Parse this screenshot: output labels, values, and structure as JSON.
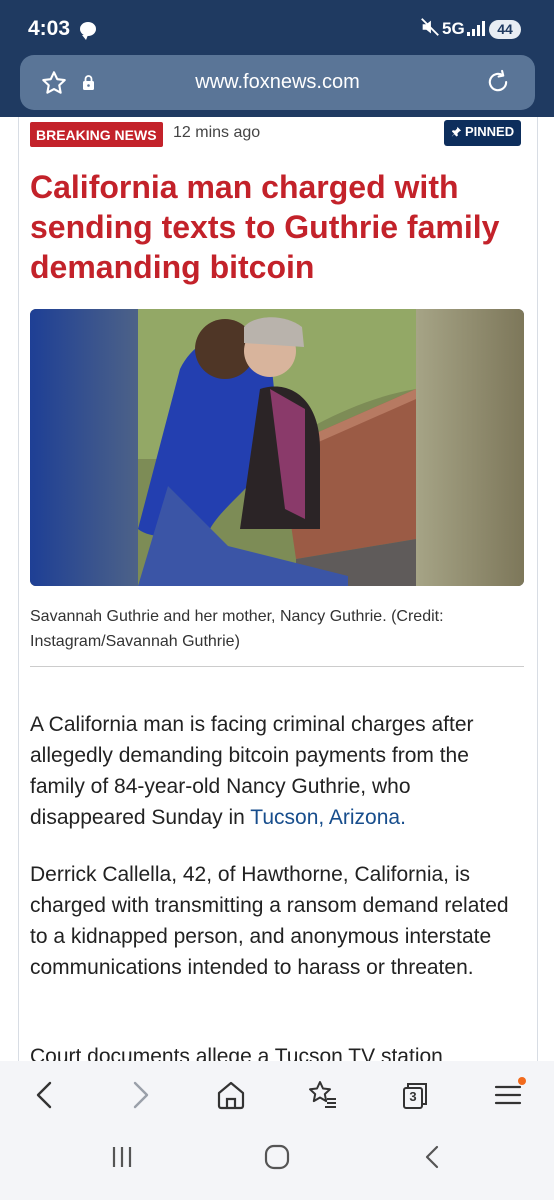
{
  "status": {
    "time": "4:03",
    "network": "5G",
    "battery": "44"
  },
  "browser": {
    "url": "www.foxnews.com"
  },
  "article": {
    "badge": "BREAKING NEWS",
    "time_ago": "12 mins ago",
    "pinned_label": "PINNED",
    "headline": "California man charged with sending texts to Guthrie family demanding bitcoin",
    "caption": "Savannah Guthrie and her mother, Nancy Guthrie. (Credit: Instagram/Savannah Guthrie)",
    "p1_before": "A California man is facing criminal charges after allegedly demanding bitcoin payments from the family of 84-year-old Nancy Guthrie, who disappeared Sunday in ",
    "p1_link": "Tucson, Arizona.",
    "p2": "Derrick Callella, 42, of Hawthorne, California, is charged with transmitting a ransom demand related to a kidnapped person, and anonymous interstate communications intended to harass or threaten.",
    "p3": "Court documents allege a Tucson TV station"
  },
  "toolbar": {
    "tabs_count": "3"
  },
  "colors": {
    "accent_red": "#c3222a",
    "navy": "#0d2e5c",
    "link": "#174d8c",
    "status_bg": "#1f3a61"
  }
}
